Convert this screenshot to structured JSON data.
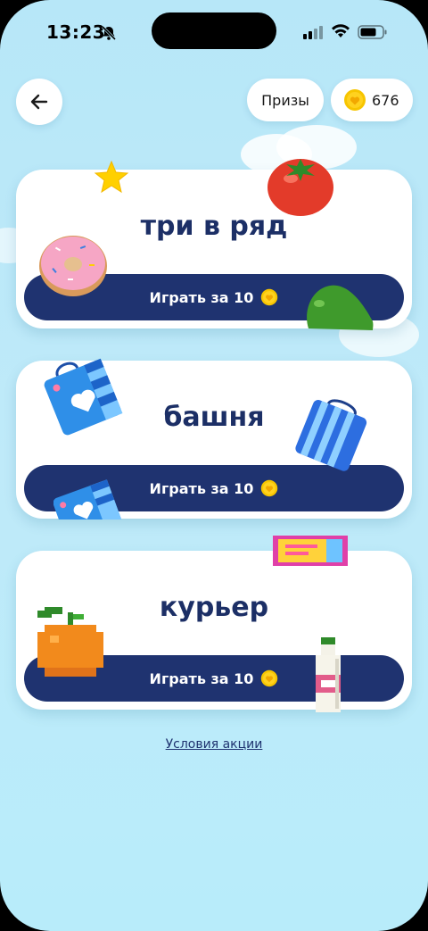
{
  "status_bar": {
    "time": "13:23"
  },
  "header": {
    "prizes_label": "Призы",
    "coin_balance": "676"
  },
  "games": [
    {
      "title": "три в ряд",
      "play_label": "Играть за 10"
    },
    {
      "title": "башня",
      "play_label": "Играть за 10"
    },
    {
      "title": "курьер",
      "play_label": "Играть за 10"
    }
  ],
  "footer": {
    "terms_link": "Условия акции"
  },
  "colors": {
    "background": "#b7e7f8",
    "button": "#1f3370",
    "title": "#1c2f66",
    "coin": "#f7c500"
  },
  "icons": [
    "back-arrow-icon",
    "coin-icon",
    "bell-slash-icon",
    "signal-icon",
    "wifi-icon",
    "battery-icon"
  ]
}
